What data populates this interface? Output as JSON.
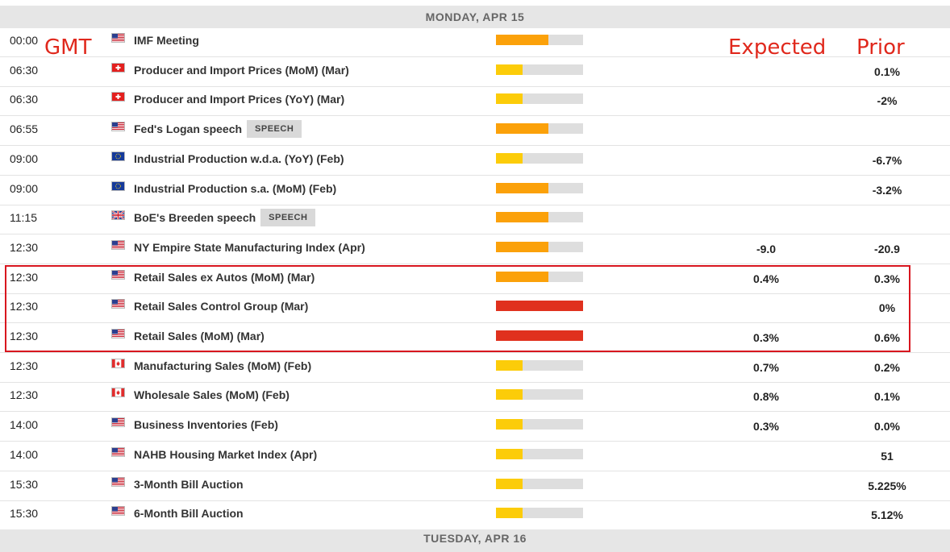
{
  "day_header": "MONDAY, APR 15",
  "next_day_header": "TUESDAY, APR 16",
  "annotations": {
    "gmt": "GMT",
    "expected": "Expected",
    "prior": "Prior"
  },
  "impact_colors": {
    "low": "#fccc09",
    "medium": "#fba10a",
    "high": "#e0311e"
  },
  "events": [
    {
      "time": "00:00",
      "flag": "us",
      "event": "IMF Meeting",
      "tag": "",
      "impact": "medium",
      "expected": "",
      "prior": ""
    },
    {
      "time": "06:30",
      "flag": "ch",
      "event": "Producer and Import Prices (MoM) (Mar)",
      "tag": "",
      "impact": "low",
      "expected": "",
      "prior": "0.1%"
    },
    {
      "time": "06:30",
      "flag": "ch",
      "event": "Producer and Import Prices (YoY) (Mar)",
      "tag": "",
      "impact": "low",
      "expected": "",
      "prior": "-2%"
    },
    {
      "time": "06:55",
      "flag": "us",
      "event": "Fed's Logan speech",
      "tag": "SPEECH",
      "impact": "medium",
      "expected": "",
      "prior": ""
    },
    {
      "time": "09:00",
      "flag": "eu",
      "event": "Industrial Production w.d.a. (YoY) (Feb)",
      "tag": "",
      "impact": "low",
      "expected": "",
      "prior": "-6.7%"
    },
    {
      "time": "09:00",
      "flag": "eu",
      "event": "Industrial Production s.a. (MoM) (Feb)",
      "tag": "",
      "impact": "medium",
      "expected": "",
      "prior": "-3.2%"
    },
    {
      "time": "11:15",
      "flag": "uk",
      "event": "BoE's Breeden speech",
      "tag": "SPEECH",
      "impact": "medium",
      "expected": "",
      "prior": ""
    },
    {
      "time": "12:30",
      "flag": "us",
      "event": "NY Empire State Manufacturing Index (Apr)",
      "tag": "",
      "impact": "medium",
      "expected": "-9.0",
      "prior": "-20.9"
    },
    {
      "time": "12:30",
      "flag": "us",
      "event": "Retail Sales ex Autos (MoM) (Mar)",
      "tag": "",
      "impact": "medium",
      "expected": "0.4%",
      "prior": "0.3%"
    },
    {
      "time": "12:30",
      "flag": "us",
      "event": "Retail Sales Control Group (Mar)",
      "tag": "",
      "impact": "high",
      "expected": "",
      "prior": "0%"
    },
    {
      "time": "12:30",
      "flag": "us",
      "event": "Retail Sales (MoM) (Mar)",
      "tag": "",
      "impact": "high",
      "expected": "0.3%",
      "prior": "0.6%"
    },
    {
      "time": "12:30",
      "flag": "ca",
      "event": "Manufacturing Sales (MoM) (Feb)",
      "tag": "",
      "impact": "low",
      "expected": "0.7%",
      "prior": "0.2%"
    },
    {
      "time": "12:30",
      "flag": "ca",
      "event": "Wholesale Sales (MoM) (Feb)",
      "tag": "",
      "impact": "low",
      "expected": "0.8%",
      "prior": "0.1%"
    },
    {
      "time": "14:00",
      "flag": "us",
      "event": "Business Inventories (Feb)",
      "tag": "",
      "impact": "low",
      "expected": "0.3%",
      "prior": "0.0%"
    },
    {
      "time": "14:00",
      "flag": "us",
      "event": "NAHB Housing Market Index (Apr)",
      "tag": "",
      "impact": "low",
      "expected": "",
      "prior": "51"
    },
    {
      "time": "15:30",
      "flag": "us",
      "event": "3-Month Bill Auction",
      "tag": "",
      "impact": "low",
      "expected": "",
      "prior": "5.225%"
    },
    {
      "time": "15:30",
      "flag": "us",
      "event": "6-Month Bill Auction",
      "tag": "",
      "impact": "low",
      "expected": "",
      "prior": "5.12%"
    }
  ]
}
